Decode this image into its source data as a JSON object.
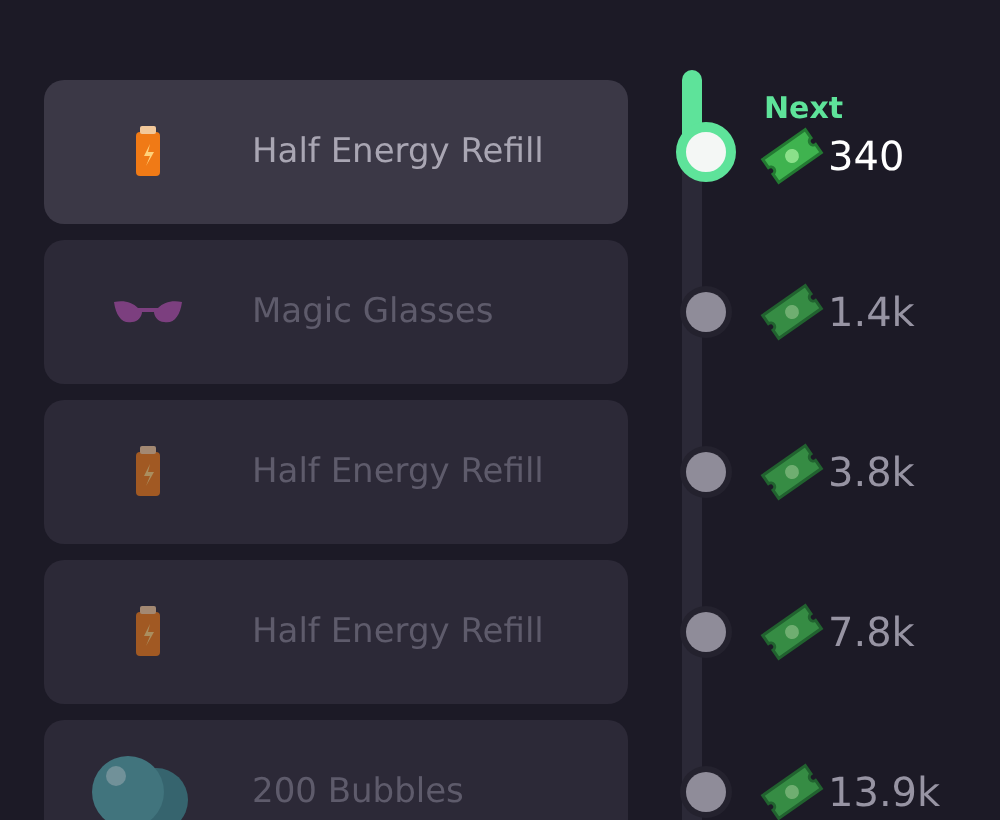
{
  "rewards": [
    {
      "kind": "battery",
      "name": "Half Energy Refill",
      "price": "340",
      "selected": true,
      "badge": "Next"
    },
    {
      "kind": "glasses",
      "name": "Magic Glasses",
      "price": "1.4k",
      "selected": false
    },
    {
      "kind": "battery",
      "name": "Half Energy Refill",
      "price": "3.8k",
      "selected": false
    },
    {
      "kind": "battery",
      "name": "Half Energy Refill",
      "price": "7.8k",
      "selected": false
    },
    {
      "kind": "bubbles",
      "name": "200 Bubbles",
      "price": "13.9k",
      "selected": false
    }
  ]
}
